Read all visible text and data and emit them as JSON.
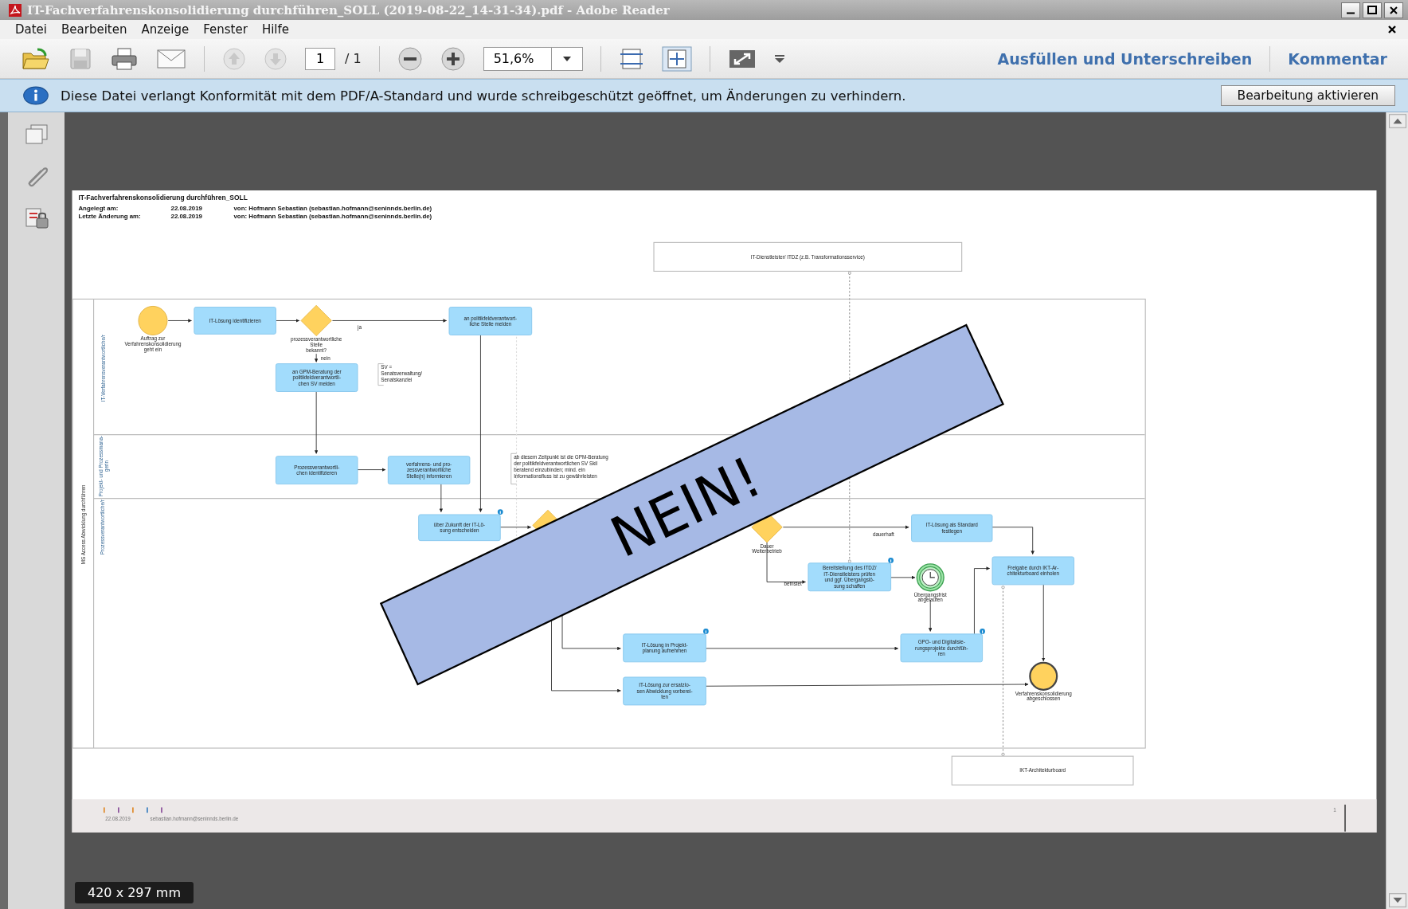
{
  "window": {
    "title": "IT-Fachverfahrenskonsolidierung durchführen_SOLL (2019-08-22_14-31-34).pdf - Adobe Reader"
  },
  "menu": [
    "Datei",
    "Bearbeiten",
    "Anzeige",
    "Fenster",
    "Hilfe"
  ],
  "toolbar": {
    "page": "1",
    "page_total": "/ 1",
    "zoom": "51,6%",
    "links": [
      "Ausfüllen und Unterschreiben",
      "Kommentar"
    ]
  },
  "infobar": {
    "message": "Diese Datei verlangt Konformität mit dem PDF/A-Standard und wurde schreibgeschützt geöffnet, um Änderungen zu verhindern.",
    "button": "Bearbeitung aktivieren"
  },
  "document": {
    "title": "IT-Fachverfahrenskonsolidierung durchführen_SOLL",
    "meta": [
      {
        "label": "Angelegt am:",
        "date": "22.08.2019",
        "by": "von: Hofmann Sebastian (sebastian.hofmann@seninnds.berlin.de)"
      },
      {
        "label": "Letzte Änderung am:",
        "date": "22.08.2019",
        "by": "von: Hofmann Sebastian (sebastian.hofmann@seninnds.berlin.de)"
      }
    ],
    "pool_label": "MS Access Abwicklung durchführen",
    "lanes": [
      {
        "lines": [
          "IT-Verfahrensverantwortliche/r"
        ]
      },
      {
        "lines": [
          "Projekt- und Prozessmana-",
          "gerin"
        ]
      },
      {
        "lines": [
          "Prozessverantwortliche/r"
        ]
      }
    ],
    "nodes": [
      {
        "kind": "external",
        "lines": [
          "IT-Dienstleister/ ITDZ (z.B. Transformationsservice)"
        ]
      },
      {
        "kind": "start",
        "lines": [
          "Auftrag zur",
          "Verfahrenskonsolidierung",
          "geht ein"
        ]
      },
      {
        "kind": "task",
        "lines": [
          "IT-Lösung identifizieren"
        ]
      },
      {
        "kind": "gateway",
        "lines": [
          "prozessverantwortliche",
          "Stelle",
          "bekannt?"
        ]
      },
      {
        "kind": "task",
        "lines": [
          "an politikfeldverantwort-",
          "liche Stelle melden"
        ]
      },
      {
        "kind": "task",
        "lines": [
          "an GPM-Beratung der",
          "politikfeldverantwortli-",
          "chen SV melden"
        ]
      },
      {
        "kind": "annotation",
        "lines": [
          "SV =",
          "Senatsverwaltung/",
          "Senatskanzlei"
        ]
      },
      {
        "kind": "task",
        "lines": [
          "Prozessverantwortli-",
          "chen identifizieren"
        ]
      },
      {
        "kind": "task",
        "lines": [
          "verfahrens- und pro-",
          "zessverantwortliche",
          "Stelle(n) informieren"
        ]
      },
      {
        "kind": "annotation",
        "lines": [
          "ab diesem Zeitpunkt ist die GPM-Beratung",
          "der politikfeldverantwortlichen SV Skil",
          "beratend einzubinden; mind. ein",
          "Informationsfluss ist zu gewährleisten"
        ]
      },
      {
        "kind": "task",
        "lines": [
          "über Zukunft der IT-Lö-",
          "sung entscheiden"
        ]
      },
      {
        "kind": "gateway"
      },
      {
        "kind": "gateway",
        "lines": [
          "Dauer",
          "Weiterbetrieb"
        ]
      },
      {
        "kind": "task",
        "lines": [
          "IT-Lösung als Standard",
          "festlegen"
        ]
      },
      {
        "kind": "task",
        "lines": [
          "Bereitstellung des ITDZ/",
          "IT-Dienstleisters prüfen",
          "und ggf. Übergangslö-",
          "sung schaffen"
        ]
      },
      {
        "kind": "timer",
        "lines": [
          "Übergangsfrist",
          "abgelaufen"
        ]
      },
      {
        "kind": "task",
        "lines": [
          "Freigabe durch IKT-Ar-",
          "chitekturboard einholen"
        ]
      },
      {
        "kind": "task",
        "lines": [
          "IT-Lösung in Projekt-",
          "planung aufnehmen"
        ]
      },
      {
        "kind": "task",
        "lines": [
          "GPO- und Digitalisie-",
          "rungsprojekte durchfüh-",
          "ren"
        ]
      },
      {
        "kind": "task",
        "lines": [
          "IT-Lösung zur ersatzlo-",
          "sen Abwicklung vorberei-",
          "ten"
        ]
      },
      {
        "kind": "end",
        "lines": [
          "Verfahrenskonsolidierung",
          "abgeschlossen"
        ]
      },
      {
        "kind": "external",
        "lines": [
          "IKT-Architekturboard"
        ]
      }
    ],
    "flow_labels": [
      "ja",
      "nein",
      "dauerhaft",
      "befristet"
    ],
    "footer": {
      "date": "22.08.2019",
      "email": "sebastian.hofmann@seninnds.berlin.de",
      "page": "1"
    }
  },
  "banner": "NEIN!",
  "page_size": "420 x 297 mm"
}
